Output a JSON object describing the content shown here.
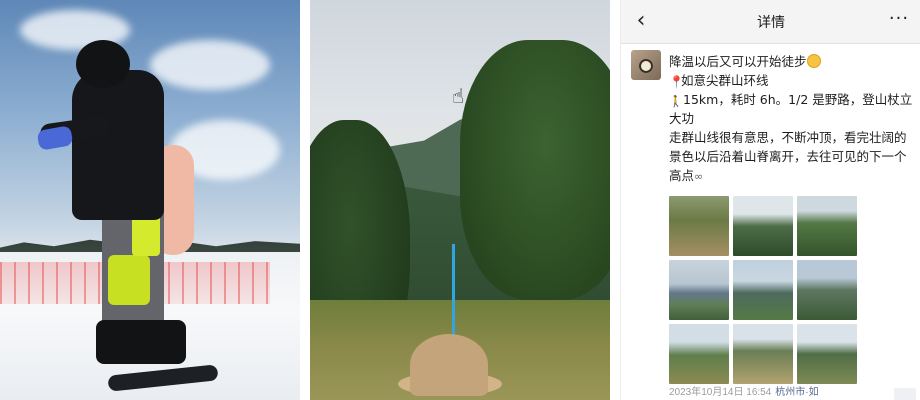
{
  "nav": {
    "back_icon": "chevron-left-icon",
    "back_glyph": "‹",
    "title": "详情",
    "more_glyph": "···"
  },
  "post": {
    "line1": "降温以后又可以开始徒步",
    "line2": "如意尖群山环线",
    "line3": "15km，耗时 6h。1/2 是野路，登山杖立大功",
    "line4": "走群山线很有意思，不断冲顶，看完壮阔的景色以后沿着山脊离开，去往可见的下一个高点",
    "pin_glyph": "📍",
    "walk_glyph": "🚶",
    "loop_glyph": "∞"
  },
  "meta": {
    "date": "2023年10月14日 16:54",
    "location": "杭州市·如"
  },
  "images": {
    "count": 9
  },
  "cursor_glyph": "☝"
}
